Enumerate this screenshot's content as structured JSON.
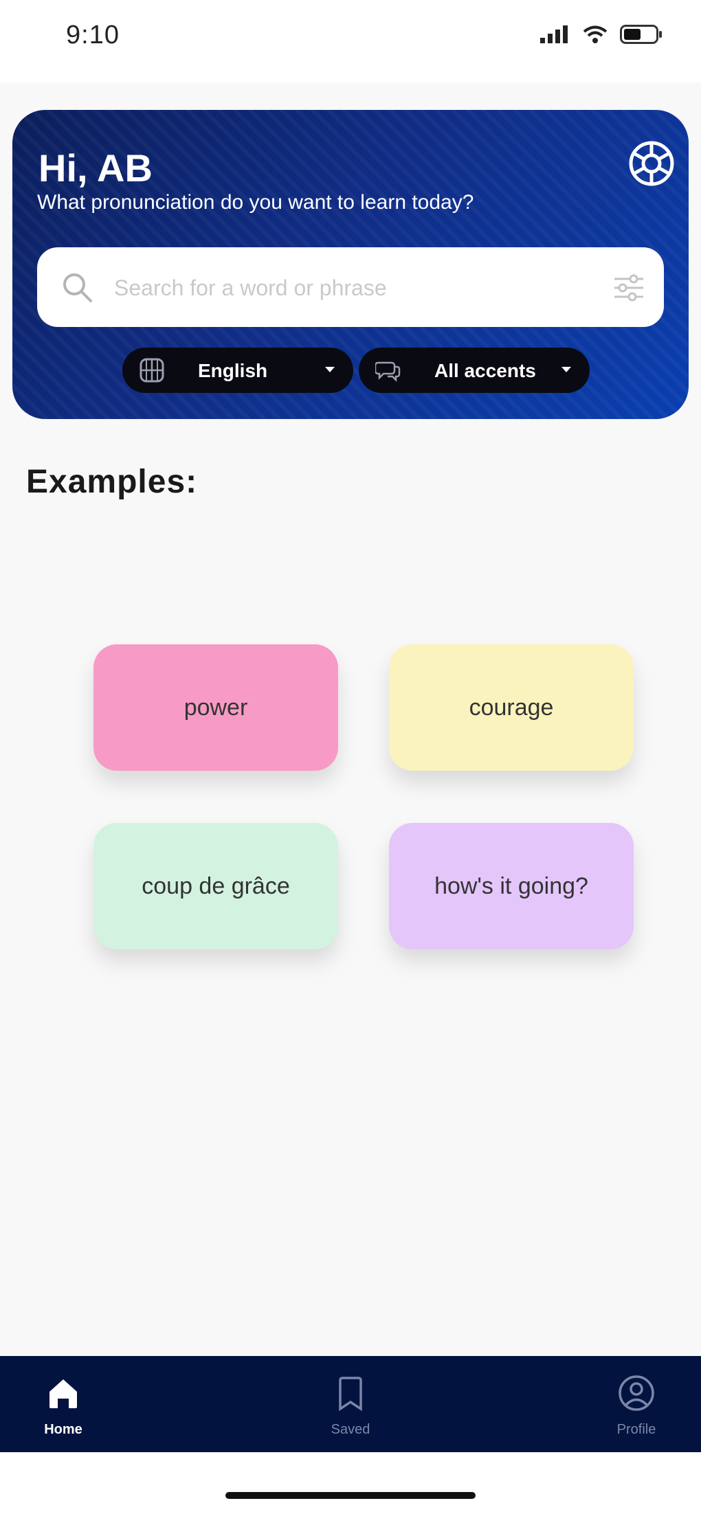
{
  "status_bar": {
    "time": "9:10"
  },
  "header": {
    "greeting": "Hi, AB",
    "subtitle": "What pronunciation do you want to learn today?"
  },
  "search": {
    "placeholder": "Search for a word or phrase",
    "value": ""
  },
  "filters": {
    "language": {
      "label": "English",
      "icon": "globe-icon"
    },
    "accent": {
      "label": "All accents",
      "icon": "speech-bubbles-icon"
    }
  },
  "examples": {
    "title": "Examples:",
    "items": [
      {
        "label": "power",
        "color": "#f79ac6"
      },
      {
        "label": "courage",
        "color": "#fbf3bd"
      },
      {
        "label": "coup de grâce",
        "color": "#d3f2e0"
      },
      {
        "label": "how's it going?",
        "color": "#e4c6fa"
      }
    ]
  },
  "nav": {
    "items": [
      {
        "label": "Home",
        "icon": "home-icon",
        "active": true
      },
      {
        "label": "Saved",
        "icon": "bookmark-icon",
        "active": false
      },
      {
        "label": "Profile",
        "icon": "profile-icon",
        "active": false
      }
    ]
  },
  "colors": {
    "header_gradient_start": "#0c1f5c",
    "header_gradient_end": "#0a3fb0",
    "nav_background": "#03133f"
  }
}
